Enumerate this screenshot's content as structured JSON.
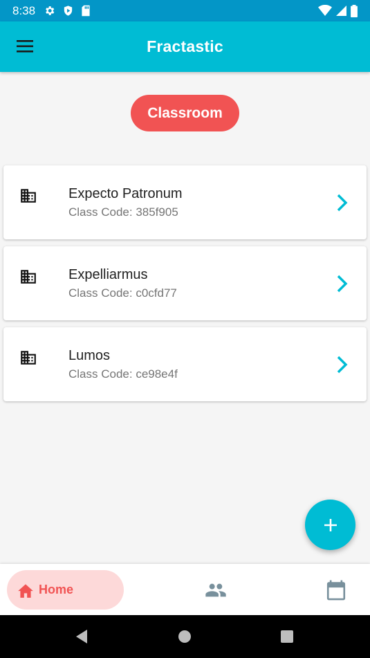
{
  "status_bar": {
    "time": "8:38",
    "left_icons": [
      "settings-icon",
      "shield-play-icon",
      "sd-card-icon"
    ],
    "right_icons": [
      "wifi-icon",
      "cell-signal-icon",
      "battery-icon"
    ]
  },
  "app_bar": {
    "title": "Fractastic",
    "menu_icon": "menu-icon"
  },
  "header_chip": {
    "label": "Classroom"
  },
  "classes": [
    {
      "name": "Expecto Patronum",
      "code": "Class Code: 385f905"
    },
    {
      "name": "Expelliarmus",
      "code": "Class Code: c0cfd77"
    },
    {
      "name": "Lumos",
      "code": "Class Code: ce98e4f"
    }
  ],
  "fab": {
    "icon": "plus-icon"
  },
  "bottom_nav": {
    "home_label": "Home",
    "items": [
      "home-icon",
      "people-icon",
      "calendar-icon"
    ]
  },
  "colors": {
    "primary": "#00bcd4",
    "status_bar": "#0396c7",
    "accent": "#f15353",
    "accent_light": "#fdd9d9",
    "nav_inactive": "#78909c"
  }
}
